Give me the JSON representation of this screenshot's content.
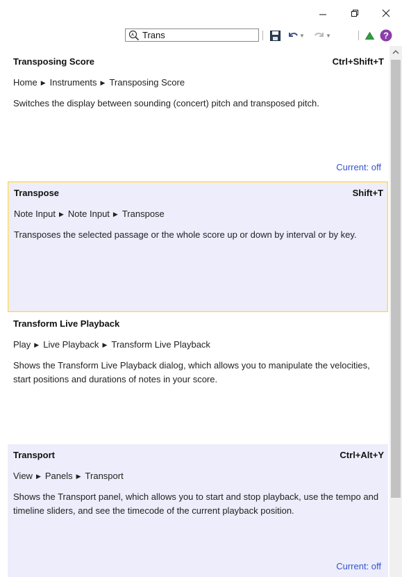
{
  "window": {
    "minimize_icon": "minimize-icon",
    "maximize_icon": "restore-icon",
    "close_icon": "close-icon"
  },
  "toolbar": {
    "search_value": "Trans",
    "icons": [
      "search-icon",
      "save-icon",
      "undo-icon",
      "redo-icon",
      "up-triangle-icon",
      "help-icon"
    ]
  },
  "results": [
    {
      "title": "Transposing Score",
      "shortcut": "Ctrl+Shift+T",
      "path": [
        "Home",
        "Instruments",
        "Transposing Score"
      ],
      "description": "Switches the display between sounding (concert) pitch and transposed pitch.",
      "status": "Current: off"
    },
    {
      "title": "Transpose",
      "shortcut": "Shift+T",
      "path": [
        "Note Input",
        "Note Input",
        "Transpose"
      ],
      "description": "Transposes the selected passage or the whole score up or down by interval or by key.",
      "status": ""
    },
    {
      "title": "Transform Live Playback",
      "shortcut": "",
      "path": [
        "Play",
        "Live Playback",
        "Transform Live Playback"
      ],
      "description": "Shows the Transform Live Playback dialog, which allows you to manipulate the velocities, start positions and durations of notes in your score.",
      "status": ""
    },
    {
      "title": "Transport",
      "shortcut": "Ctrl+Alt+Y",
      "path": [
        "View",
        "Panels",
        "Transport"
      ],
      "description": "Shows the Transport panel, which allows you to start and stop playback, use the tempo and timeline sliders, and see the timecode of the current playback position.",
      "status": "Current: off"
    }
  ],
  "colors": {
    "selected_bg": "#ededfb",
    "selected_border": "#f2d46a",
    "status_text": "#3355cc",
    "help_icon": "#8a3fa8",
    "green_icon": "#2e9e3e"
  }
}
